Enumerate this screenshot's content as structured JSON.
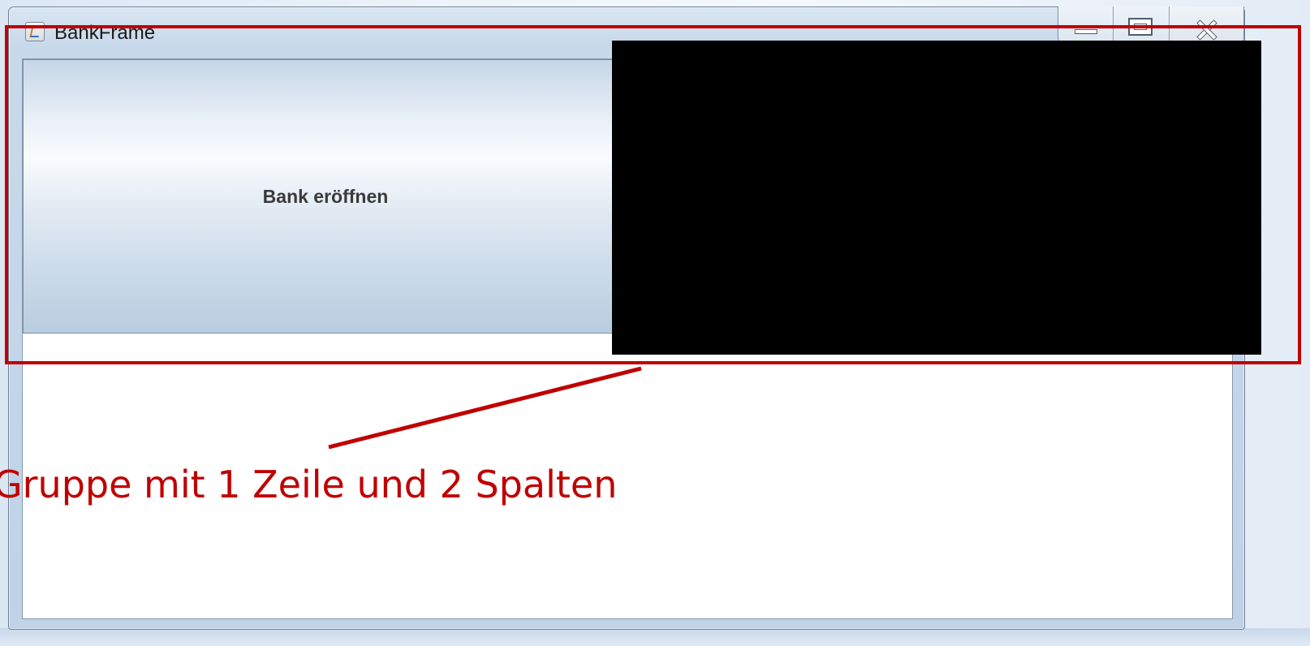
{
  "window": {
    "title": "BankFrame",
    "controls": {
      "minimize_icon": "minimize-icon",
      "maximize_icon": "maximize-icon",
      "close_icon": "close-icon"
    }
  },
  "main": {
    "bank_button_label": "Bank eröffnen"
  },
  "annotation": {
    "label": "Gruppe mit 1 Zeile und 2 Spalten",
    "color": "#c00000"
  },
  "colors": {
    "redaction": "#000000"
  }
}
